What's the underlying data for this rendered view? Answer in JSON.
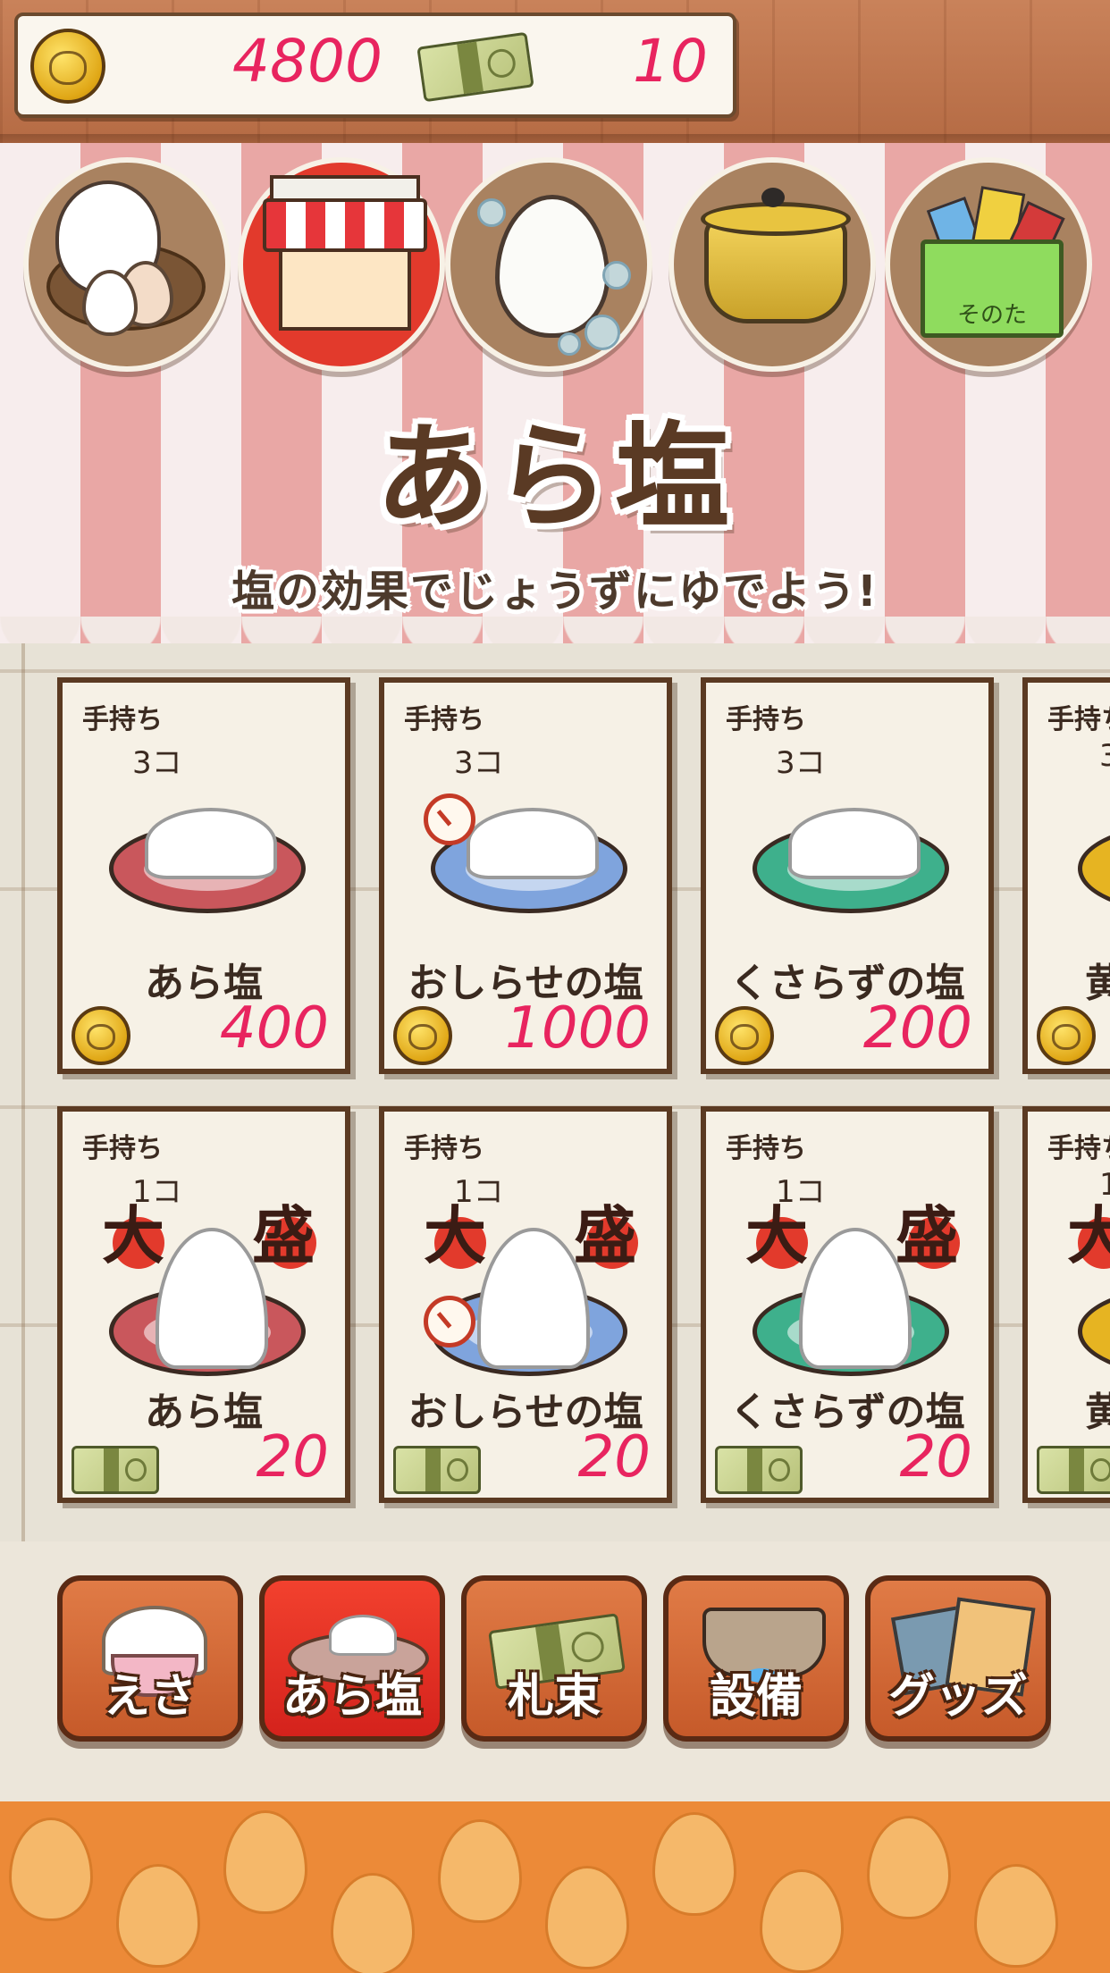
{
  "currency": {
    "coins": "4800",
    "bills": "10"
  },
  "categories": [
    {
      "id": "hens",
      "icon": "hen-nest-icon",
      "active": false
    },
    {
      "id": "shop",
      "icon": "shop-stall-icon",
      "active": true
    },
    {
      "id": "boil",
      "icon": "boiling-egg-icon",
      "active": false
    },
    {
      "id": "pot",
      "icon": "pot-icon",
      "active": false
    },
    {
      "id": "other",
      "icon": "goods-box-icon",
      "active": false,
      "label": "そのた"
    }
  ],
  "page": {
    "title": "あら塩",
    "subtitle": "塩の効果でじょうずにゆでよう!"
  },
  "stock_label": "手持ち",
  "items_row1": [
    {
      "stock": "3コ",
      "name": "あら塩",
      "price": "400",
      "currency": "coin",
      "plate_color": "#c9575c"
    },
    {
      "stock": "3コ",
      "name": "おしらせの塩",
      "price": "1000",
      "currency": "coin",
      "plate_color": "#7fa4dd",
      "clock": true
    },
    {
      "stock": "3コ",
      "name": "くさらずの塩",
      "price": "200",
      "currency": "coin",
      "plate_color": "#3eb08c"
    },
    {
      "stock": "3",
      "name": "黄",
      "price": "",
      "currency": "coin",
      "plate_color": "#e6b422"
    }
  ],
  "items_row2": [
    {
      "stock": "1コ",
      "name": "あら塩",
      "price": "20",
      "currency": "bill",
      "plate_color": "#c9575c",
      "badge": [
        "大",
        "盛"
      ]
    },
    {
      "stock": "1コ",
      "name": "おしらせの塩",
      "price": "20",
      "currency": "bill",
      "plate_color": "#7fa4dd",
      "clock": true,
      "badge": [
        "大",
        "盛"
      ]
    },
    {
      "stock": "1コ",
      "name": "くさらずの塩",
      "price": "20",
      "currency": "bill",
      "plate_color": "#3eb08c",
      "badge": [
        "大",
        "盛"
      ]
    },
    {
      "stock": "1",
      "name": "黄",
      "price": "",
      "currency": "bill",
      "plate_color": "#e6b422",
      "badge": [
        "大"
      ]
    }
  ],
  "tabs": [
    {
      "label": "えさ",
      "icon": "feed-bowl-icon",
      "active": false
    },
    {
      "label": "あら塩",
      "icon": "salt-plate-icon",
      "active": true
    },
    {
      "label": "札束",
      "icon": "cash-stack-icon",
      "active": false
    },
    {
      "label": "設備",
      "icon": "stove-pot-icon",
      "active": false
    },
    {
      "label": "グッズ",
      "icon": "goods-cards-icon",
      "active": false
    }
  ],
  "colors": {
    "accent_price": "#e8245f",
    "frame": "#5b3a22",
    "tab": "#d4692f",
    "tab_active": "#e3271f"
  }
}
